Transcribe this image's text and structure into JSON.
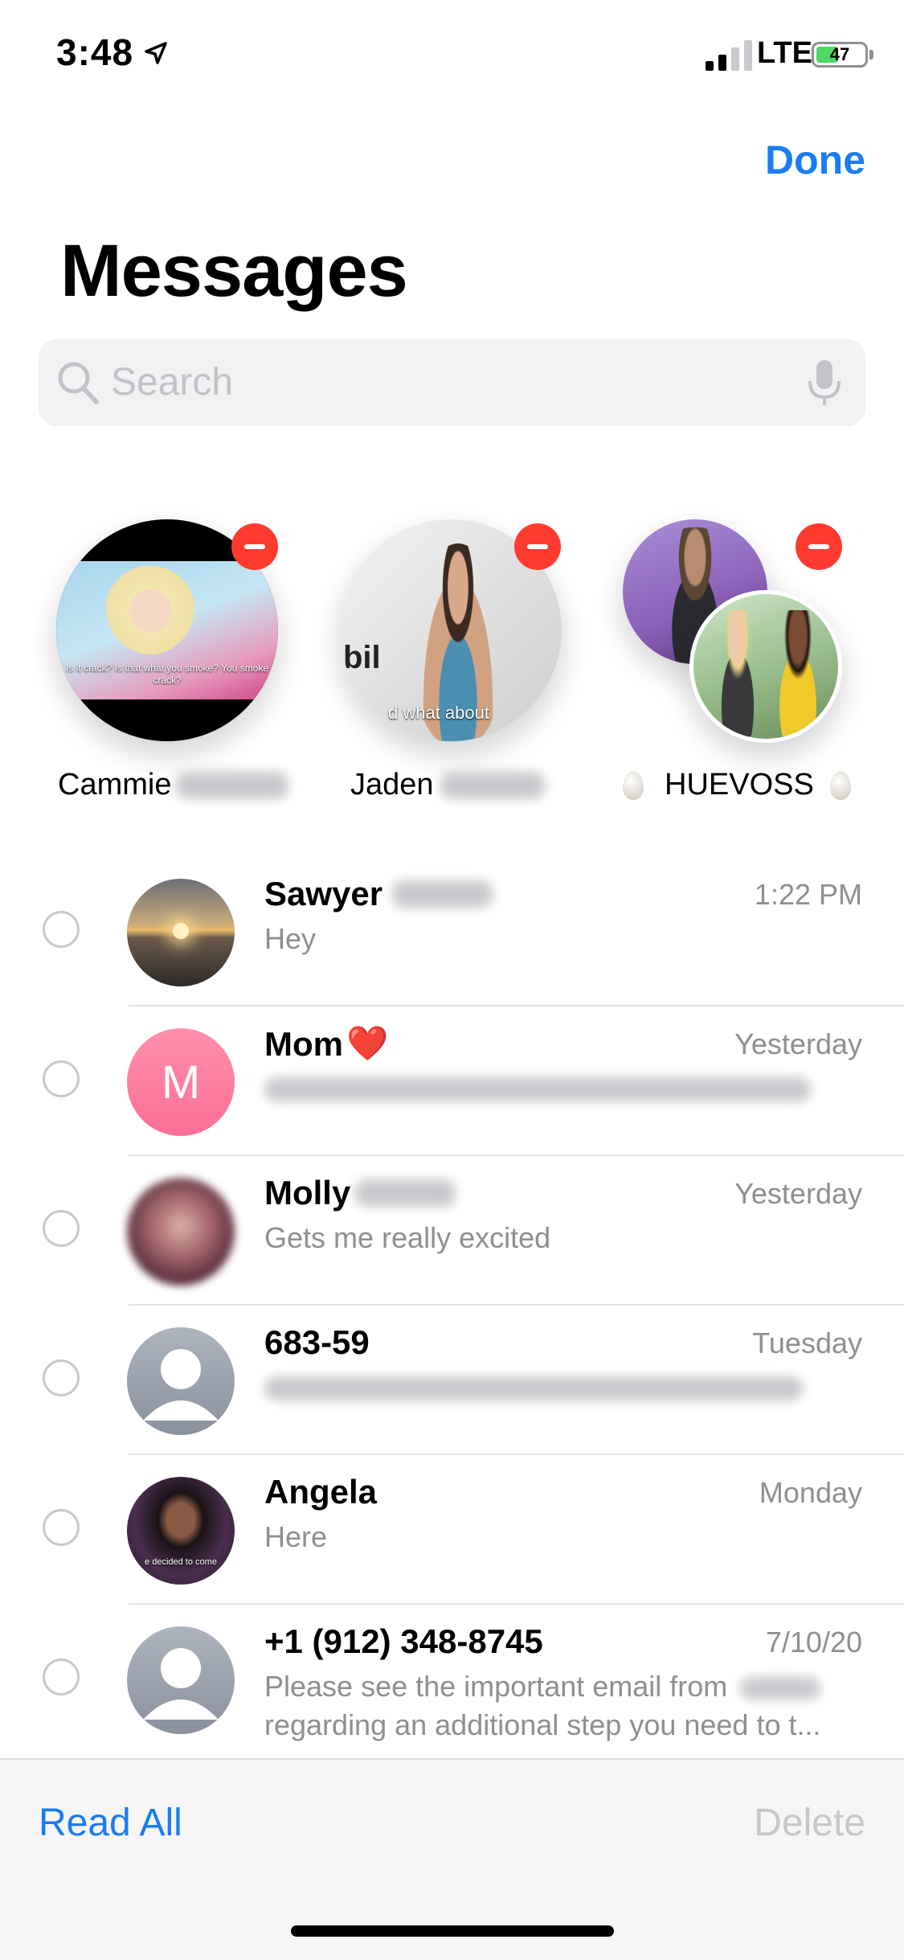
{
  "status_bar": {
    "time": "3:48",
    "network": "LTE",
    "battery": "47",
    "battery_level": 0.47
  },
  "header": {
    "done_label": "Done",
    "title": "Messages"
  },
  "search": {
    "placeholder": "Search"
  },
  "pinned": [
    {
      "name": "Cammie",
      "caption": "Is it crack? Is that what you smoke? You smoke crack?"
    },
    {
      "name": "Jaden",
      "caption": "d what about"
    },
    {
      "name": "HUEVOSS"
    }
  ],
  "conversations": [
    {
      "name": "Sawyer",
      "time": "1:22 PM",
      "preview": "Hey"
    },
    {
      "name": "Mom",
      "emoji": "❤️",
      "initial": "M",
      "time": "Yesterday",
      "preview": ""
    },
    {
      "name": "Molly",
      "time": "Yesterday",
      "preview": "Gets me really excited"
    },
    {
      "name": "683-59",
      "time": "Tuesday",
      "preview": ""
    },
    {
      "name": "Angela",
      "time": "Monday",
      "preview": "Here",
      "caption": "e decided to come"
    },
    {
      "name": "+1 (912) 348-8745",
      "time": "7/10/20",
      "preview": "Please see the important email from",
      "preview_line2": "regarding an additional step you need to t..."
    }
  ],
  "toolbar": {
    "read_all_label": "Read All",
    "delete_label": "Delete"
  },
  "colors": {
    "accent": "#1a7cf5",
    "remove": "#ff3b30",
    "secondary_text": "#8e8e93"
  }
}
